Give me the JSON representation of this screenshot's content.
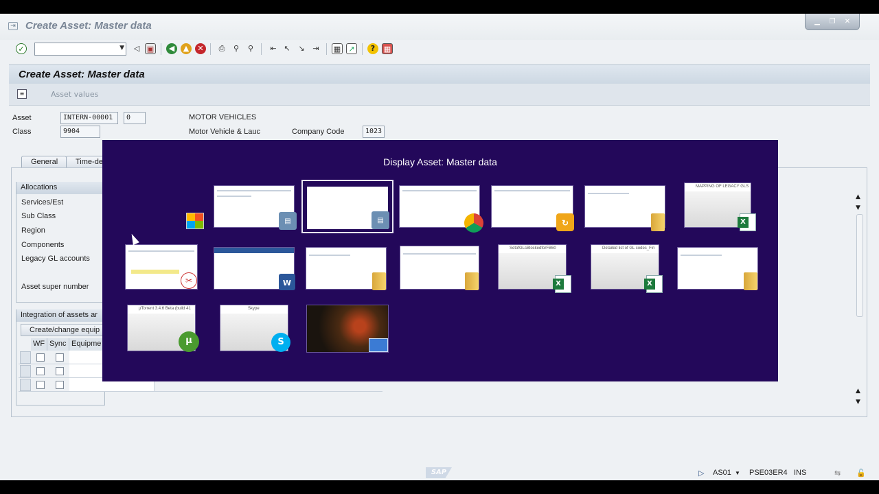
{
  "window": {
    "title": "Create Asset:  Master data",
    "controls": [
      "minimize",
      "restore",
      "close"
    ]
  },
  "toolbar": {
    "command_field_value": "",
    "icons": [
      "enter-icon",
      "back-icon",
      "save-icon",
      "back-green-icon",
      "exit-icon",
      "cancel-icon",
      "print-icon",
      "find-icon",
      "find-next-icon",
      "first-page-icon",
      "prev-page-icon",
      "next-page-icon",
      "last-page-icon",
      "create-session-icon",
      "shortcut-icon",
      "help-icon",
      "layout-icon"
    ]
  },
  "header": {
    "title": "Create Asset:  Master data",
    "asset_values_label": "Asset values"
  },
  "form": {
    "asset_label": "Asset",
    "asset_value": "INTERN-00001",
    "subnumber_value": "0",
    "asset_description": "MOTOR VEHICLES",
    "class_label": "Class",
    "class_value": "9904",
    "class_description": "Motor Vehicle & Lauc",
    "company_code_label": "Company Code",
    "company_code_value": "1023"
  },
  "tabs": [
    {
      "label": "General"
    },
    {
      "label": "Time-de"
    }
  ],
  "allocations": {
    "header": "Allocations",
    "items": [
      "Services/Est",
      "Sub Class",
      "Region",
      "Components",
      "Legacy GL accounts",
      "Asset super number"
    ]
  },
  "integration": {
    "header": "Integration of assets ar",
    "button": "Create/change equip",
    "columns": [
      "WF",
      "Sync",
      "Equipme"
    ],
    "rows": 3
  },
  "switcher": {
    "title": "Display Asset:  Master data",
    "thumbnails": [
      {
        "caption": "",
        "app": "sap-icon"
      },
      {
        "caption": "",
        "app": "sap-icon"
      },
      {
        "caption": "",
        "app": "chrome-icon"
      },
      {
        "caption": "",
        "app": "sap-logon-icon"
      },
      {
        "caption": "",
        "app": "folder-icon"
      },
      {
        "caption": "MAPPING OF LEGACY GLS",
        "app": "excel-icon"
      },
      {
        "caption": "",
        "app": "snipping-tool-icon"
      },
      {
        "caption": "",
        "app": "word-icon"
      },
      {
        "caption": "",
        "app": "folder-icon"
      },
      {
        "caption": "",
        "app": "folder-icon"
      },
      {
        "caption": "SetofGLsBlockedforFB60",
        "app": "excel-icon"
      },
      {
        "caption": "Detailed list of GL codes_Fin",
        "app": "excel-icon"
      },
      {
        "caption": "",
        "app": "folder-icon"
      },
      {
        "caption": "µTorrent 3.4.6 Beta (build 41",
        "app": "utorrent-icon"
      },
      {
        "caption": "Skype",
        "app": "skype-icon"
      },
      {
        "caption": "",
        "app": "desktop-icon"
      }
    ]
  },
  "status": {
    "transaction": "AS01",
    "server": "PSE03ER4",
    "mode": "INS",
    "logo": "SAP"
  },
  "colors": {
    "switcher_bg": "#23085a",
    "header_bg": "#cdd8e3",
    "window_bg": "#eef1f4"
  }
}
